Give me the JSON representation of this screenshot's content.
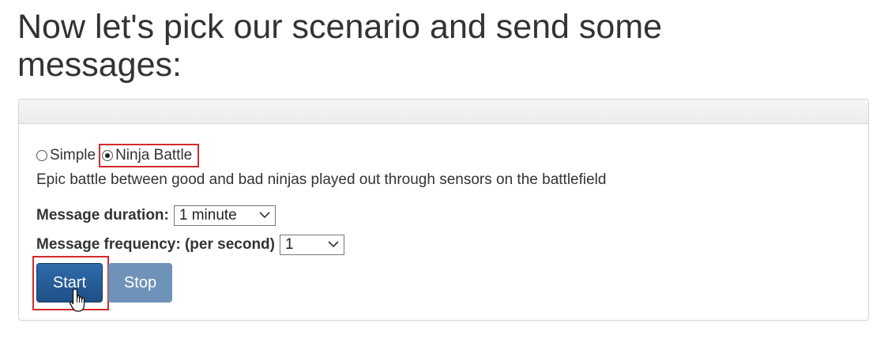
{
  "heading": "Now let's pick our scenario and send some messages:",
  "scenario": {
    "options": [
      {
        "label": "Simple",
        "checked": false
      },
      {
        "label": "Ninja Battle",
        "checked": true
      }
    ],
    "description": "Epic battle between good and bad ninjas played out through sensors on the battlefield"
  },
  "duration": {
    "label": "Message duration:",
    "value": "1 minute"
  },
  "frequency": {
    "label": "Message frequency: (per second)",
    "value": "1"
  },
  "buttons": {
    "start": "Start",
    "stop": "Stop"
  },
  "icons": {
    "dropdown": "chevron-down-icon",
    "cursor": "hand-pointer-icon"
  },
  "colors": {
    "start_button": "#1f4f86",
    "stop_button": "#6f93b8",
    "highlight_box": "#d42a2a"
  }
}
